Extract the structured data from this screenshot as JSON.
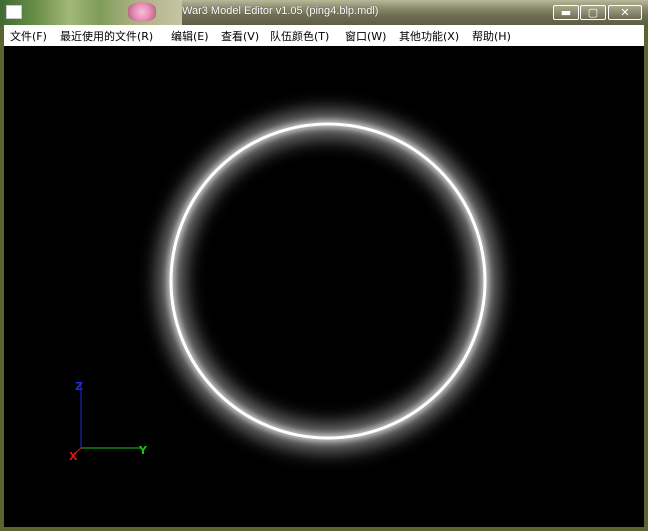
{
  "window": {
    "title": "War3 Model Editor v1.05 (ping4.blp.mdl)",
    "controls": {
      "minimize": "▬",
      "maximize": "▢",
      "close": "✕"
    },
    "colors": {
      "frame": "#5d6233",
      "titlebar": "#7a7a5f",
      "viewport": "#000000"
    }
  },
  "menu": {
    "items": [
      {
        "label": "文件(F)"
      },
      {
        "label": "最近使用的文件(R)"
      },
      {
        "label": "编辑(E)"
      },
      {
        "label": "查看(V)"
      },
      {
        "label": "队伍颜色(T)"
      },
      {
        "label": "窗口(W)"
      },
      {
        "label": "其他功能(X)"
      },
      {
        "label": "帮助(H)"
      }
    ]
  },
  "viewport": {
    "axes": {
      "z": "Z",
      "y": "Y",
      "x": "X"
    },
    "axis_colors": {
      "z": "#1a2bd6",
      "y": "#19c419",
      "x": "#d61a1a"
    },
    "model": "glowing-ring"
  }
}
